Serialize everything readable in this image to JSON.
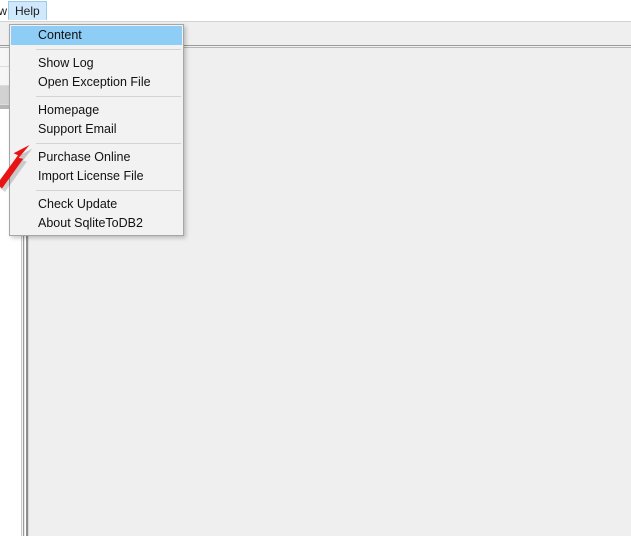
{
  "window": {
    "background_color": "#efefef",
    "panel_color": "#ffffff"
  },
  "menu_bar": {
    "items": [
      {
        "label": "w",
        "truncated": true,
        "open": false
      },
      {
        "label": "Help",
        "truncated": false,
        "open": true
      }
    ],
    "background_color": "#ffffff",
    "open_item_highlight_color": "#cfe8fb"
  },
  "help_menu": {
    "open": true,
    "highlight_color": "#8ecdf5",
    "background_color": "#f2f2f2",
    "border_color": "#a6a6a6",
    "groups": [
      {
        "items": [
          {
            "label": "Content",
            "selected": true
          }
        ]
      },
      {
        "items": [
          {
            "label": "Show Log",
            "selected": false
          },
          {
            "label": "Open Exception File",
            "selected": false
          }
        ]
      },
      {
        "items": [
          {
            "label": "Homepage",
            "selected": false
          },
          {
            "label": "Support Email",
            "selected": false
          }
        ]
      },
      {
        "items": [
          {
            "label": "Purchase Online",
            "selected": false
          },
          {
            "label": "Import License File",
            "selected": false
          }
        ]
      },
      {
        "items": [
          {
            "label": "Check Update",
            "selected": false
          },
          {
            "label": "About SqliteToDB2",
            "selected": false
          }
        ]
      }
    ]
  },
  "annotation": {
    "type": "arrow",
    "color": "#e81313",
    "points_to": "Purchase Online"
  }
}
